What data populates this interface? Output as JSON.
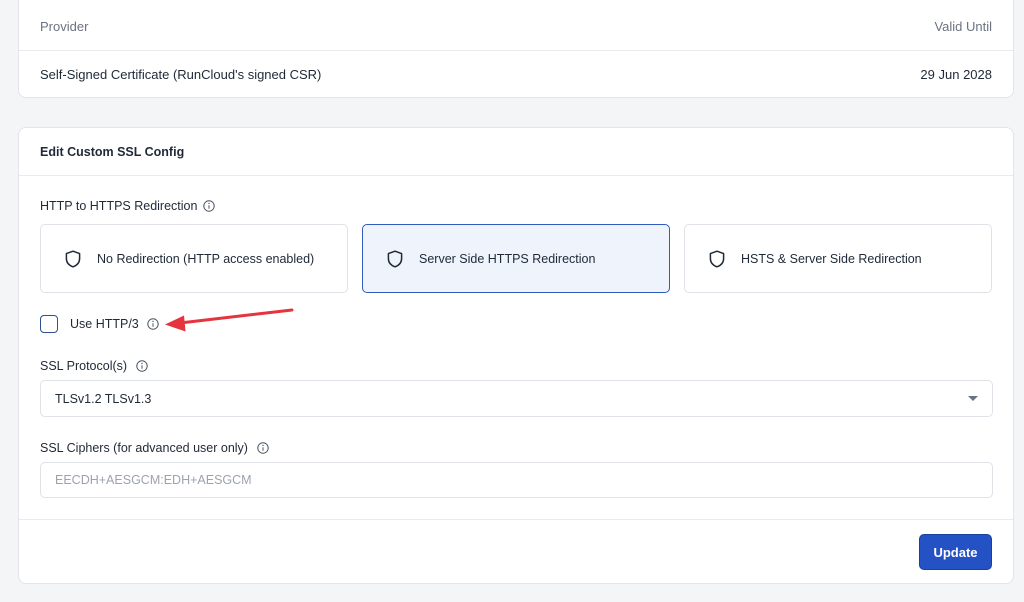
{
  "certificate": {
    "headers": {
      "provider": "Provider",
      "valid_until": "Valid Until"
    },
    "row": {
      "provider": "Self-Signed Certificate (RunCloud's signed CSR)",
      "valid_until": "29 Jun 2028"
    }
  },
  "ssl_config": {
    "title": "Edit Custom SSL Config",
    "redirection": {
      "label": "HTTP to HTTPS Redirection",
      "options": [
        {
          "label": "No Redirection (HTTP access enabled)",
          "icon": "shield-icon"
        },
        {
          "label": "Server Side HTTPS Redirection",
          "icon": "shield-icon",
          "selected": true
        },
        {
          "label": "HSTS & Server Side Redirection",
          "icon": "shield-icon"
        }
      ]
    },
    "http3": {
      "label": "Use HTTP/3",
      "checked": false
    },
    "protocols": {
      "label": "SSL Protocol(s)",
      "value": "TLSv1.2 TLSv1.3"
    },
    "ciphers": {
      "label": "SSL Ciphers (for advanced user only)",
      "value": "",
      "placeholder": "EECDH+AESGCM:EDH+AESGCM"
    },
    "update_label": "Update"
  },
  "colors": {
    "accent": "#2451c4",
    "selected_bg": "#eef3fc",
    "annotation_arrow": "#e5343d"
  }
}
